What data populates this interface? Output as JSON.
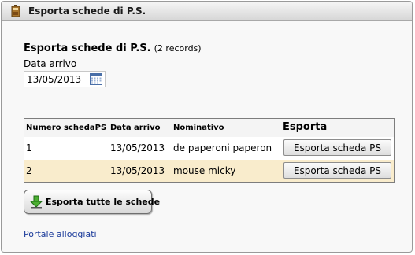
{
  "window": {
    "title": "Esporta schede di P.S."
  },
  "header": {
    "title": "Esporta schede di P.S.",
    "records": "(2 records)"
  },
  "filter": {
    "label": "Data arrivo",
    "date_value": "13/05/2013"
  },
  "table": {
    "columns": [
      "Numero schedaPS",
      "Data arrivo",
      "Nominativo",
      "Esporta"
    ],
    "rows": [
      {
        "numero": "1",
        "data": "13/05/2013",
        "nominativo": "de paperoni paperon",
        "action": "Esporta scheda PS"
      },
      {
        "numero": "2",
        "data": "13/05/2013",
        "nominativo": "mouse micky",
        "action": "Esporta scheda PS"
      }
    ]
  },
  "export_all": {
    "label": "Esporta tutte le schede"
  },
  "footer": {
    "link": "Portale alloggiati"
  },
  "colors": {
    "row_alt": "#f9eccc",
    "link": "#1a3a9a"
  },
  "icons": [
    "police-badge-icon",
    "calendar-icon",
    "download-arrow-icon"
  ]
}
